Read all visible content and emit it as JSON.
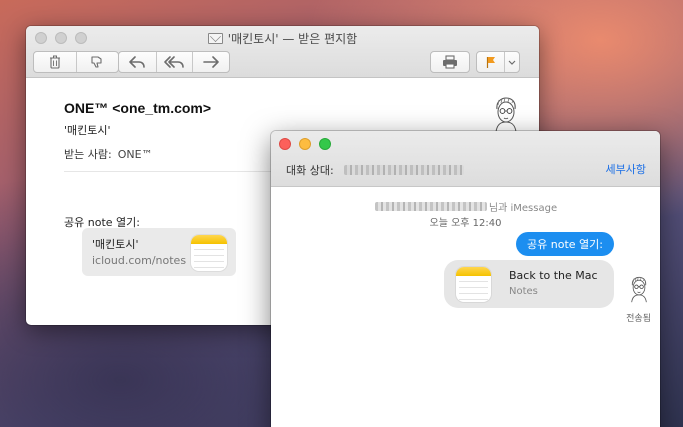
{
  "mail": {
    "window_title": "'매킨토시' — 받은 편지함",
    "toolbar": {
      "delete_icon": "trash-icon",
      "junk_icon": "thumbs-down-icon",
      "reply_icon": "reply-icon",
      "reply_all_icon": "reply-all-icon",
      "forward_icon": "forward-icon",
      "print_icon": "printer-icon",
      "flag_icon": "flag-icon",
      "flag_color": "#f29a1e"
    },
    "from": "ONE™ <one_tm.com>",
    "subject": "'매킨토시'",
    "to_label": "받는 사람:",
    "to_value": "ONE™",
    "body_label": "공유 note 열기:",
    "attachment": {
      "title": "'매킨토시'",
      "url": "icloud.com/notes"
    }
  },
  "messages": {
    "to_label": "대화 상대:",
    "details_label": "세부사항",
    "link_color": "#1b6fe6",
    "sender_suffix": "님과 iMessage",
    "time_label": "오늘 오후 12:40",
    "bubble_text": "공유 note 열기:",
    "bubble_color": "#1c8ef0",
    "card": {
      "title": "Back to the Mac",
      "subtitle": "Notes"
    },
    "status": "전송됨"
  }
}
